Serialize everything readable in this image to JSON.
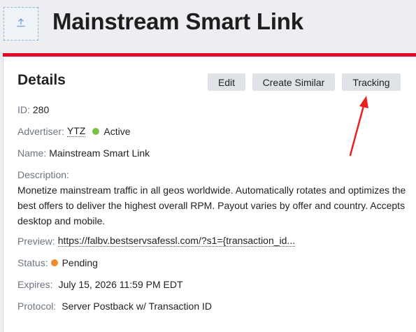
{
  "header": {
    "title": "Mainstream Smart Link",
    "upload_icon": "upload-icon"
  },
  "accent_color": "#e10a2a",
  "card": {
    "title": "Details",
    "buttons": {
      "edit": "Edit",
      "create_similar": "Create Similar",
      "tracking": "Tracking"
    },
    "fields": {
      "id_label": "ID:",
      "id_value": "280",
      "advertiser_label": "Advertiser:",
      "advertiser_value": "YTZ",
      "advertiser_status": "Active",
      "advertiser_status_color": "#78c04a",
      "name_label": "Name:",
      "name_value": "Mainstream Smart Link",
      "description_label": "Description:",
      "description_value": "Monetize mainstream traffic in all geos worldwide. Automatically rotates and optimizes the best offers to deliver the highest overall RPM. Payout varies by offer and country. Accepts desktop and mobile.",
      "preview_label": "Preview:",
      "preview_value": "https://falbv.bestservsafessl.com/?s1={transaction_id...",
      "status_label": "Status:",
      "status_value": "Pending",
      "status_color": "#f08a2e",
      "expires_label": "Expires:",
      "expires_value": "July 15, 2026 11:59 PM EDT",
      "protocol_label": "Protocol:",
      "protocol_value": "Server Postback w/ Transaction ID"
    }
  },
  "annotation": {
    "arrow_color": "#e8231f"
  }
}
